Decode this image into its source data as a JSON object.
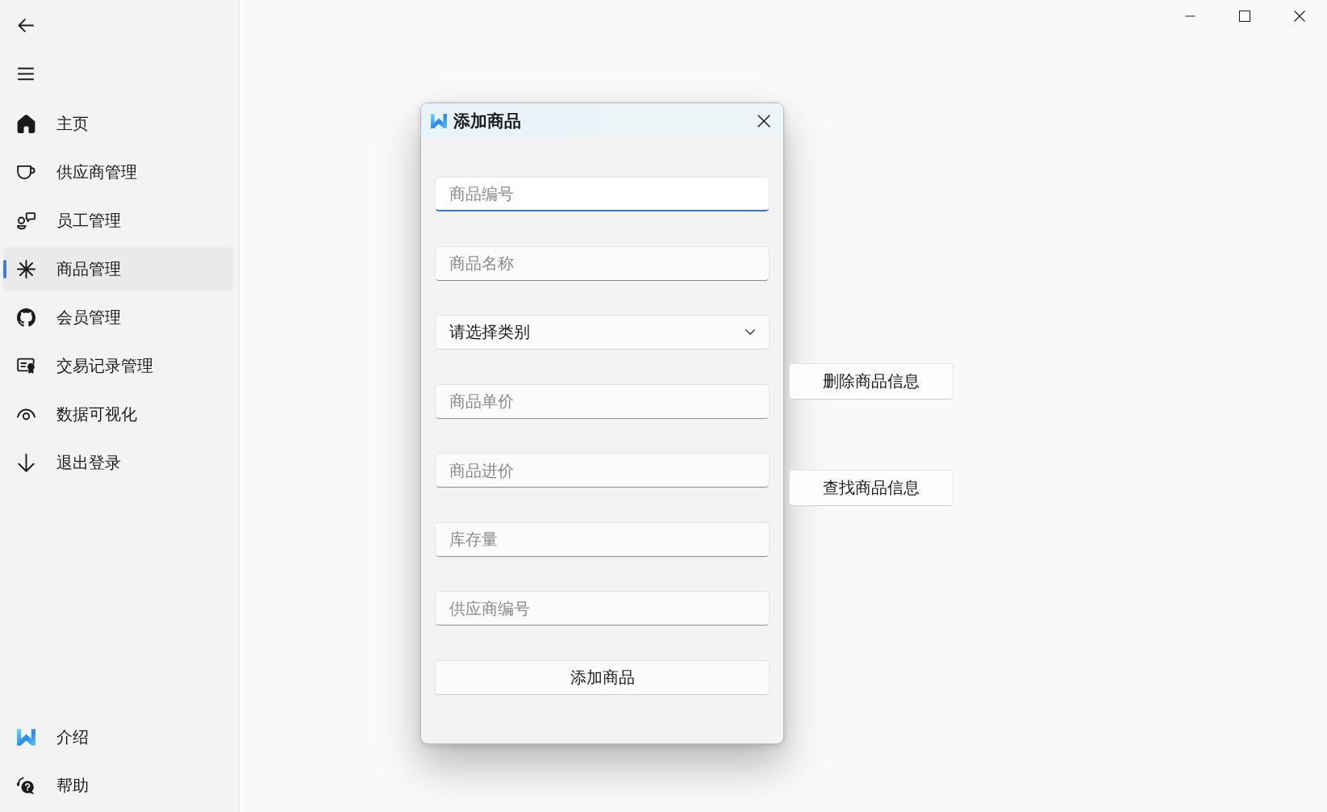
{
  "sidebar": {
    "items": [
      {
        "label": "主页",
        "selected": false
      },
      {
        "label": "供应商管理",
        "selected": false
      },
      {
        "label": "员工管理",
        "selected": false
      },
      {
        "label": "商品管理",
        "selected": true
      },
      {
        "label": "会员管理",
        "selected": false
      },
      {
        "label": "交易记录管理",
        "selected": false
      },
      {
        "label": "数据可视化",
        "selected": false
      },
      {
        "label": "退出登录",
        "selected": false
      }
    ],
    "footer_items": [
      {
        "label": "介绍",
        "selected": false
      },
      {
        "label": "帮助",
        "selected": false
      }
    ]
  },
  "dialog": {
    "title": "添加商品",
    "fields": [
      {
        "kind": "text",
        "placeholder": "商品编号",
        "focused": true
      },
      {
        "kind": "text",
        "placeholder": "商品名称",
        "focused": false
      },
      {
        "kind": "select",
        "value": "请选择类别",
        "focused": false
      },
      {
        "kind": "text",
        "placeholder": "商品单价",
        "focused": false
      },
      {
        "kind": "text",
        "placeholder": "商品进价",
        "focused": false
      },
      {
        "kind": "text",
        "placeholder": "库存量",
        "focused": false
      },
      {
        "kind": "text",
        "placeholder": "供应商编号",
        "focused": false
      }
    ],
    "submit_button": "添加商品"
  },
  "action_buttons": [
    "删除商品信息",
    "查找商品信息"
  ]
}
